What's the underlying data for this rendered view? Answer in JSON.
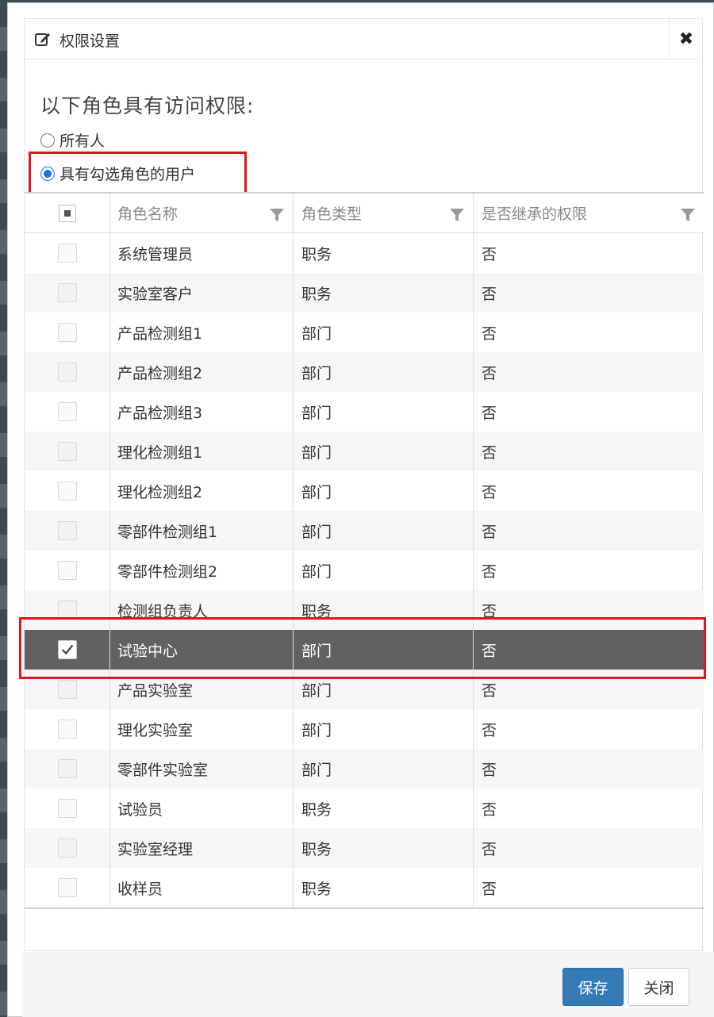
{
  "dialog": {
    "title": "权限设置",
    "close_symbol": "✖",
    "icon": "edit-icon"
  },
  "access": {
    "prompt": "以下角色具有访问权限:",
    "options": [
      {
        "label": "所有人",
        "selected": false
      },
      {
        "label": "具有勾选角色的用户",
        "selected": true
      }
    ]
  },
  "table": {
    "columns": [
      "角色名称",
      "角色类型",
      "是否继承的权限"
    ],
    "rows": [
      {
        "name": "系统管理员",
        "type": "职务",
        "inherited": "否",
        "checked": false
      },
      {
        "name": "实验室客户",
        "type": "职务",
        "inherited": "否",
        "checked": false
      },
      {
        "name": "产品检测组1",
        "type": "部门",
        "inherited": "否",
        "checked": false
      },
      {
        "name": "产品检测组2",
        "type": "部门",
        "inherited": "否",
        "checked": false
      },
      {
        "name": "产品检测组3",
        "type": "部门",
        "inherited": "否",
        "checked": false
      },
      {
        "name": "理化检测组1",
        "type": "部门",
        "inherited": "否",
        "checked": false
      },
      {
        "name": "理化检测组2",
        "type": "部门",
        "inherited": "否",
        "checked": false
      },
      {
        "name": "零部件检测组1",
        "type": "部门",
        "inherited": "否",
        "checked": false
      },
      {
        "name": "零部件检测组2",
        "type": "部门",
        "inherited": "否",
        "checked": false
      },
      {
        "name": "检测组负责人",
        "type": "职务",
        "inherited": "否",
        "checked": false
      },
      {
        "name": "试验中心",
        "type": "部门",
        "inherited": "否",
        "checked": true
      },
      {
        "name": "产品实验室",
        "type": "部门",
        "inherited": "否",
        "checked": false
      },
      {
        "name": "理化实验室",
        "type": "部门",
        "inherited": "否",
        "checked": false
      },
      {
        "name": "零部件实验室",
        "type": "部门",
        "inherited": "否",
        "checked": false
      },
      {
        "name": "试验员",
        "type": "职务",
        "inherited": "否",
        "checked": false
      },
      {
        "name": "实验室经理",
        "type": "职务",
        "inherited": "否",
        "checked": false
      },
      {
        "name": "收样员",
        "type": "职务",
        "inherited": "否",
        "checked": false
      }
    ]
  },
  "footer": {
    "save_label": "保存",
    "close_label": "关闭"
  },
  "colors": {
    "highlight": "#e0161e",
    "selected_row": "#616161",
    "primary": "#337ab7"
  }
}
